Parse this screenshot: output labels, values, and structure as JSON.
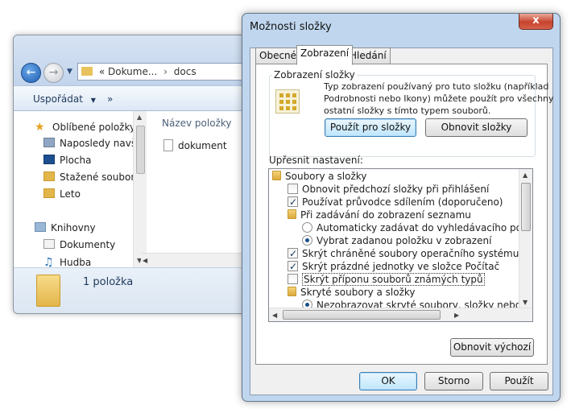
{
  "explorer": {
    "address": {
      "prefix": "«",
      "crumbs": [
        "Dokume...",
        "docs"
      ],
      "separator": "›"
    },
    "toolbar": {
      "organize": "Uspořádat",
      "organize_arrow": "▼",
      "more": "»"
    },
    "nav": {
      "favorites": "Oblíbené položky",
      "recent": "Naposledy navšti",
      "desktop": "Plocha",
      "downloads": "Stažené soubory",
      "leto": "Leto",
      "libraries": "Knihovny",
      "documents": "Dokumenty",
      "music": "Hudba"
    },
    "column_header": "Název položky",
    "files": [
      "dokument"
    ],
    "status": "1 položka"
  },
  "dialog": {
    "title": "Možnosti složky",
    "close_glyph": "x",
    "tabs": [
      "Obecné",
      "Zobrazení",
      "Hledání"
    ],
    "active_tab": "Zobrazení",
    "folder_views": {
      "label": "Zobrazení složky",
      "description": "Typ zobrazení používaný pro tuto složku (například Podrobnosti nebo Ikony) můžete použít pro všechny ostatní složky s tímto typem souborů.",
      "apply_button": "Použít pro složky",
      "reset_button": "Obnovit složky"
    },
    "advanced": {
      "label": "Upřesnit nastavení:",
      "items": [
        {
          "type": "folder",
          "text": "Soubory a složky"
        },
        {
          "type": "checkbox",
          "checked": false,
          "text": "Obnovit předchozí složky při přihlášení"
        },
        {
          "type": "checkbox",
          "checked": true,
          "text": "Používat průvodce sdílením (doporučeno)"
        },
        {
          "type": "folder",
          "text": "Při zadávání do zobrazení seznamu"
        },
        {
          "type": "radio",
          "checked": false,
          "text": "Automaticky zadávat do vyhledávacího pole"
        },
        {
          "type": "radio",
          "checked": true,
          "text": "Vybrat zadanou položku v zobrazení"
        },
        {
          "type": "checkbox",
          "checked": true,
          "text": "Skrýt chráněné soubory operačního systému (doporučeno)"
        },
        {
          "type": "checkbox",
          "checked": true,
          "text": "Skrýt prázdné jednotky ve složce Počítač"
        },
        {
          "type": "checkbox",
          "checked": false,
          "text": "Skrýt příponu souborů známých typů"
        },
        {
          "type": "folder",
          "text": "Skryté soubory a složky"
        },
        {
          "type": "radio",
          "checked": true,
          "text": "Nezobrazovat skryté soubory, složky nebo jednotky"
        }
      ]
    },
    "restore_defaults": "Obnovit výchozí",
    "ok": "OK",
    "cancel": "Storno",
    "apply": "Použít"
  },
  "colors": {
    "accent": "#3c7fb1",
    "frame": "#bfd6ee",
    "close": "#c7432c"
  },
  "icons": [
    "back-arrow-icon",
    "forward-arrow-icon",
    "folder-icon",
    "star-icon",
    "document-icon",
    "music-icon",
    "library-icon",
    "folder-view-icon"
  ]
}
